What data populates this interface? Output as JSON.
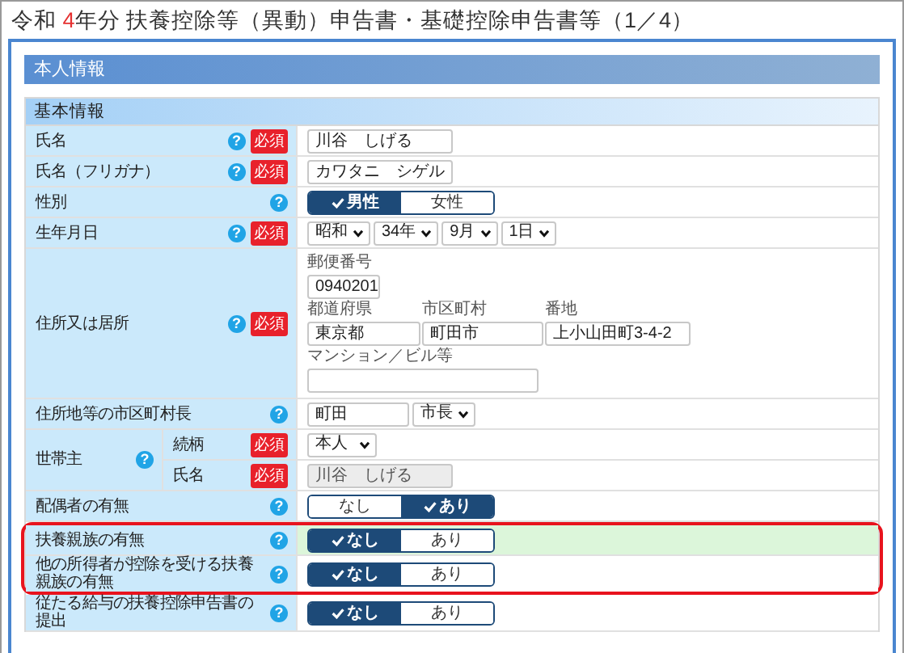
{
  "title": [
    {
      "text": "令和 ",
      "emphasis": false
    },
    {
      "text": "4",
      "emphasis": true
    },
    {
      "text": "年分 扶養控除等（異動）申告書・基礎控除申告書等（1／4）",
      "emphasis": false
    }
  ],
  "section": "本人情報",
  "subsection": "基本情報",
  "rows": [
    {
      "kind": "text",
      "label": "氏名",
      "help": "?",
      "required": "必須",
      "value": "川谷　しげる",
      "highlighted": false,
      "flagged": false
    },
    {
      "kind": "text",
      "label": "氏名（フリガナ）",
      "help": "?",
      "required": "必須",
      "value": "カワタニ　シゲル",
      "highlighted": false,
      "flagged": false
    },
    {
      "kind": "toggle",
      "label": "性別",
      "help": "?",
      "options": [
        {
          "label": "男性",
          "selected": true
        },
        {
          "label": "女性",
          "selected": false
        }
      ],
      "highlighted": false,
      "flagged": false
    },
    {
      "kind": "selects",
      "label": "生年月日",
      "help": "?",
      "required": "必須",
      "selects": [
        "昭和",
        "34年",
        "9月",
        "1日"
      ],
      "highlighted": false,
      "flagged": false
    },
    {
      "kind": "address",
      "label": "住所又は居所",
      "help": "?",
      "required": "必須",
      "lines": [
        [
          {
            "label": "郵便番号",
            "value": "0940201"
          }
        ],
        [
          {
            "label": "都道府県",
            "value": "東京都"
          },
          {
            "label": "市区町村",
            "value": "町田市"
          },
          {
            "label": "番地",
            "value": "上小山田町3-4-2"
          }
        ],
        [
          {
            "label": "マンション／ビル等"
          }
        ]
      ],
      "highlighted": false,
      "flagged": false
    },
    {
      "kind": "city",
      "label": "住所地等の市区町村長",
      "help": "?",
      "value": "町田",
      "select": "市長",
      "highlighted": false,
      "flagged": false
    },
    {
      "kind": "group",
      "label": "世帯主",
      "help": "?",
      "children": [
        {
          "kind": "select",
          "label": "続柄",
          "required": "必須",
          "select": "本人"
        },
        {
          "kind": "text",
          "label": "氏名",
          "required": "必須",
          "value": "川谷　しげる",
          "disabled": true
        }
      ],
      "highlighted": false,
      "flagged": false
    },
    {
      "kind": "toggle",
      "label": "配偶者の有無",
      "help": "?",
      "options": [
        {
          "label": "なし",
          "selected": false
        },
        {
          "label": "あり",
          "selected": true
        }
      ],
      "highlighted": false,
      "flagged": false
    },
    {
      "kind": "toggle",
      "label": "扶養親族の有無",
      "help": "?",
      "options": [
        {
          "label": "なし",
          "selected": true
        },
        {
          "label": "あり",
          "selected": false
        }
      ],
      "highlighted": true,
      "flagged": true
    },
    {
      "kind": "toggle",
      "label": "他の所得者が控除を受ける扶養親族の有無",
      "help": "?",
      "options": [
        {
          "label": "なし",
          "selected": true
        },
        {
          "label": "あり",
          "selected": false
        }
      ],
      "highlighted": false,
      "flagged": true
    },
    {
      "kind": "toggle",
      "label": "従たる給与の扶養控除申告書の提出",
      "help": "?",
      "options": [
        {
          "label": "なし",
          "selected": true
        },
        {
          "label": "あり",
          "selected": false
        }
      ],
      "highlighted": false,
      "flagged": false
    }
  ]
}
